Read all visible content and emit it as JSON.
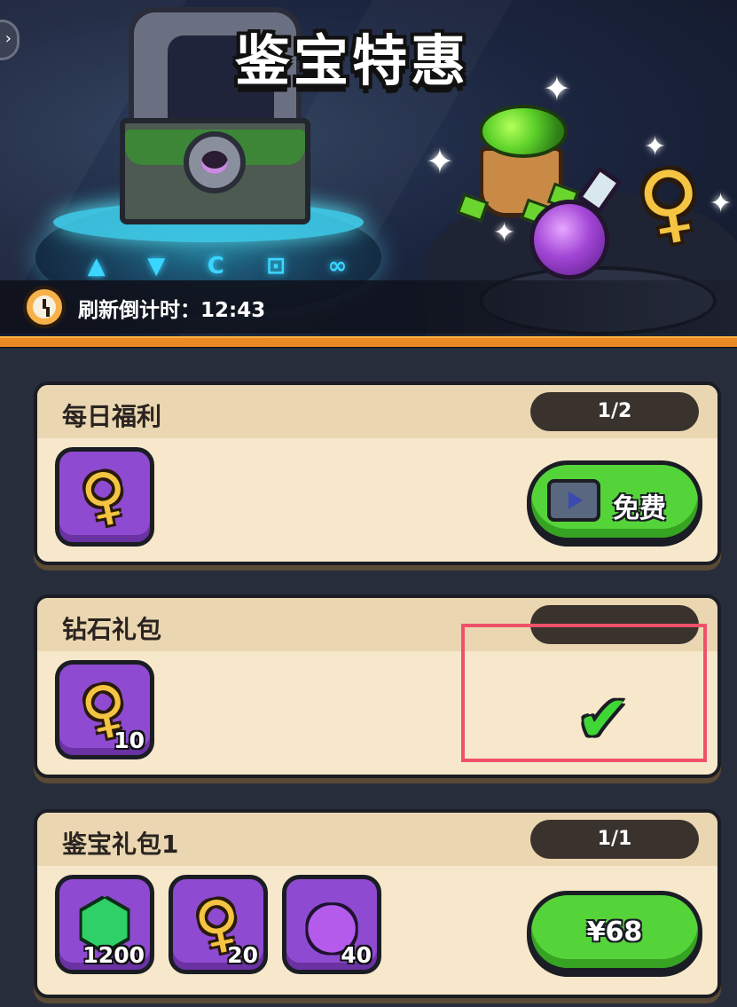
{
  "header": {
    "title": "鉴宝特惠",
    "timer_label": "刷新倒计时：12:43",
    "rune_glyphs": [
      "▲",
      "▼",
      "C",
      "⊡",
      "∞"
    ]
  },
  "offers": [
    {
      "title": "每日福利",
      "progress": "1/2",
      "items": [
        {
          "icon": "key-icon",
          "qty": ""
        }
      ],
      "action": {
        "type": "free",
        "label": "免费",
        "icon": "tv-icon"
      }
    },
    {
      "title": "钻石礼包",
      "progress": "",
      "items": [
        {
          "icon": "key-icon",
          "qty": "10"
        }
      ],
      "action": {
        "type": "claimed",
        "icon": "check-icon"
      }
    },
    {
      "title": "鉴宝礼包1",
      "progress": "1/1",
      "items": [
        {
          "icon": "gem-icon",
          "qty": "1200"
        },
        {
          "icon": "key-icon",
          "qty": "20"
        },
        {
          "icon": "potion-icon",
          "qty": "40"
        }
      ],
      "action": {
        "type": "buy",
        "label": "¥68"
      }
    }
  ],
  "colors": {
    "accent_orange": "#e98a25",
    "green_button": "#55d43a",
    "item_purple": "#8e4bd1",
    "card_bg": "#f7e8cb",
    "highlight_red": "#f0516a"
  }
}
